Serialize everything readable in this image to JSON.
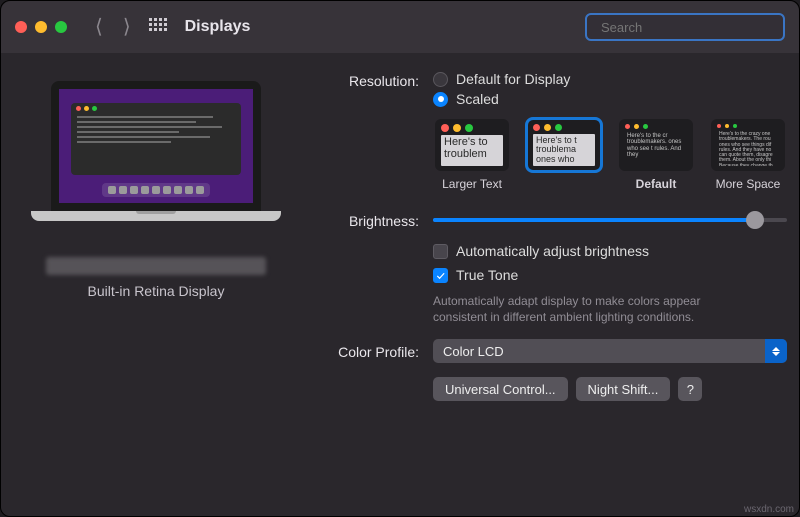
{
  "window": {
    "title": "Displays"
  },
  "traffic": {
    "close": "#ff5f57",
    "min": "#febc2e",
    "max": "#28c840"
  },
  "search": {
    "placeholder": "Search",
    "value": ""
  },
  "sidebar": {
    "device_label": "Built-in Retina Display"
  },
  "resolution": {
    "label": "Resolution:",
    "options": [
      {
        "label": "Default for Display",
        "selected": false
      },
      {
        "label": "Scaled",
        "selected": true
      }
    ],
    "thumbs": [
      {
        "id": "larger",
        "caption": "Larger Text",
        "selected": false,
        "dot_size": 8,
        "font_px": 11,
        "text": "Here's to troublem"
      },
      {
        "id": "mid1",
        "caption": "",
        "selected": true,
        "dot_size": 7,
        "font_px": 9,
        "text": "Here's to t troublema ones who"
      },
      {
        "id": "default",
        "caption": "Default",
        "selected": false,
        "dot_size": 5,
        "font_px": 6,
        "text": "Here's to the cr troublemakers. ones who see t rules. And they"
      },
      {
        "id": "more",
        "caption": "More Space",
        "selected": false,
        "dot_size": 4,
        "font_px": 5,
        "text": "Here's to the crazy one troublemakers. The rou ones who see things dif rules. And they have no can quote them, disagre them. About the only thi Because they change th"
      }
    ]
  },
  "brightness": {
    "label": "Brightness:",
    "value_pct": 91
  },
  "auto_brightness": {
    "label": "Automatically adjust brightness",
    "checked": false
  },
  "true_tone": {
    "label": "True Tone",
    "checked": true,
    "description": "Automatically adapt display to make colors appear consistent in different ambient lighting conditions."
  },
  "color_profile": {
    "label": "Color Profile:",
    "value": "Color LCD"
  },
  "buttons": {
    "universal": "Universal Control...",
    "night": "Night Shift...",
    "help": "?"
  },
  "watermark": "wsxdn.com"
}
